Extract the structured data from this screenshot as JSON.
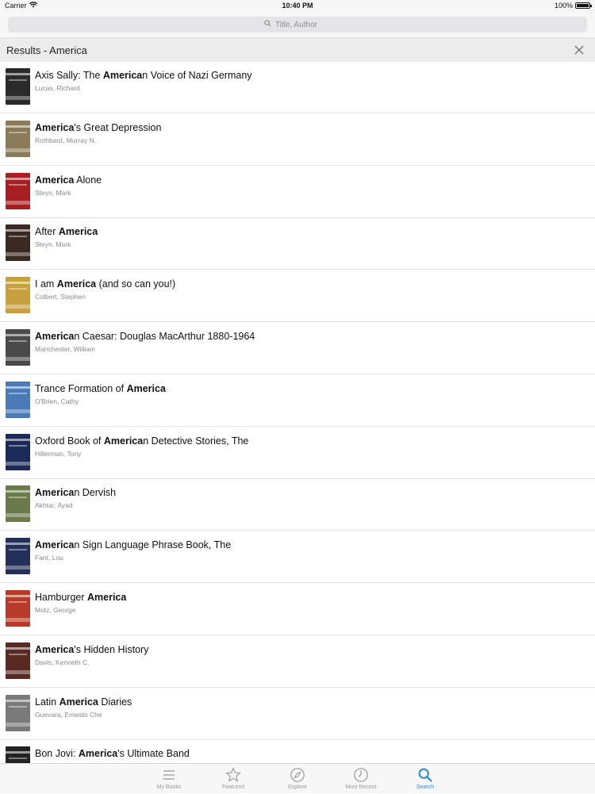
{
  "status_bar": {
    "carrier": "Carrier",
    "time": "10:40 PM",
    "battery": "100%",
    "battery_level": 1.0
  },
  "search": {
    "placeholder": "Title, Author"
  },
  "results_header": {
    "title": "Results - America"
  },
  "results": [
    {
      "parts": [
        [
          "Axis Sally: The ",
          false
        ],
        [
          "America",
          true
        ],
        [
          "n Voice of Nazi Germany",
          false
        ]
      ],
      "author": "Lucas, Richard",
      "cover_color": "#2a2a2a"
    },
    {
      "parts": [
        [
          "America",
          true
        ],
        [
          "'s Great Depression",
          false
        ]
      ],
      "author": "Rothbard, Murray N.",
      "cover_color": "#8a7a58"
    },
    {
      "parts": [
        [
          "America",
          true
        ],
        [
          " Alone",
          false
        ]
      ],
      "author": "Steyn, Mark",
      "cover_color": "#a81e22"
    },
    {
      "parts": [
        [
          "After ",
          false
        ],
        [
          "America",
          true
        ]
      ],
      "author": "Steyn, Mark",
      "cover_color": "#3a2a22"
    },
    {
      "parts": [
        [
          "I am ",
          false
        ],
        [
          "America",
          true
        ],
        [
          " (and so can you!)",
          false
        ]
      ],
      "author": "Colbert, Stephen",
      "cover_color": "#c8a040"
    },
    {
      "parts": [
        [
          "America",
          true
        ],
        [
          "n Caesar: Douglas MacArthur 1880-1964",
          false
        ]
      ],
      "author": "Manchester, William",
      "cover_color": "#4a4a4a"
    },
    {
      "parts": [
        [
          "Trance Formation of ",
          false
        ],
        [
          "America",
          true
        ]
      ],
      "author": "O'Brien, Cathy",
      "cover_color": "#4a7ab8"
    },
    {
      "parts": [
        [
          "Oxford Book of ",
          false
        ],
        [
          "America",
          true
        ],
        [
          "n Detective Stories, The",
          false
        ]
      ],
      "author": "Hillerman, Tony",
      "cover_color": "#1c2a5a"
    },
    {
      "parts": [
        [
          "America",
          true
        ],
        [
          "n Dervish",
          false
        ]
      ],
      "author": "Akhtar, Ayad",
      "cover_color": "#6a7a4a"
    },
    {
      "parts": [
        [
          "America",
          true
        ],
        [
          "n Sign Language Phrase Book, The",
          false
        ]
      ],
      "author": "Fant, Lou",
      "cover_color": "#23305a"
    },
    {
      "parts": [
        [
          "Hamburger ",
          false
        ],
        [
          "America",
          true
        ]
      ],
      "author": "Motz, George",
      "cover_color": "#b83a28"
    },
    {
      "parts": [
        [
          "America",
          true
        ],
        [
          "'s Hidden History",
          false
        ]
      ],
      "author": "Davis, Kenneth C.",
      "cover_color": "#5a2a22"
    },
    {
      "parts": [
        [
          "Latin ",
          false
        ],
        [
          "America",
          true
        ],
        [
          " Diaries",
          false
        ]
      ],
      "author": "Guevara, Ernesto Che",
      "cover_color": "#7a7a7a"
    },
    {
      "parts": [
        [
          "Bon Jovi: ",
          false
        ],
        [
          "America",
          true
        ],
        [
          "'s Ultimate Band",
          false
        ]
      ],
      "author": "",
      "cover_color": "#222222"
    }
  ],
  "tabs": [
    {
      "label": "My Books",
      "icon": "list-icon",
      "active": false
    },
    {
      "label": "Featured",
      "icon": "star-icon",
      "active": false
    },
    {
      "label": "Explore",
      "icon": "compass-icon",
      "active": false
    },
    {
      "label": "Most Recent",
      "icon": "clock-icon",
      "active": false
    },
    {
      "label": "Search",
      "icon": "search-icon",
      "active": true
    }
  ],
  "colors": {
    "accent": "#2a8ae0",
    "inactive": "#9a9a9a"
  }
}
